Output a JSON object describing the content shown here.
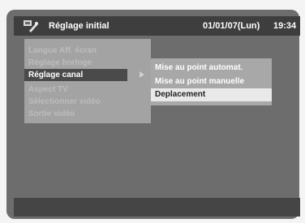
{
  "header": {
    "title": "Réglage initial",
    "date": "01/01/07(Lun)",
    "time": "19:34"
  },
  "menu": {
    "items": [
      {
        "label": "Langue Aff. écran"
      },
      {
        "label": "Réglage horloge"
      },
      {
        "label": "Réglage canal"
      },
      {
        "label": "Aspect TV"
      },
      {
        "label": "Sélectionner vidéo"
      },
      {
        "label": "Sortie vidéo"
      }
    ],
    "active_index": 2
  },
  "submenu": {
    "items": [
      {
        "label": "Mise au point automat."
      },
      {
        "label": "Mise au point manuelle"
      },
      {
        "label": "Deplacement"
      }
    ],
    "selected_index": 2
  },
  "colors": {
    "screen_bg": "#6d6d6d",
    "header_bg": "#3e3e3e",
    "selection_bg": "#e9e9e9"
  },
  "icons": {
    "header_icon": "setup-wrench-icon",
    "submenu_arrow": "triangle-right-icon"
  }
}
